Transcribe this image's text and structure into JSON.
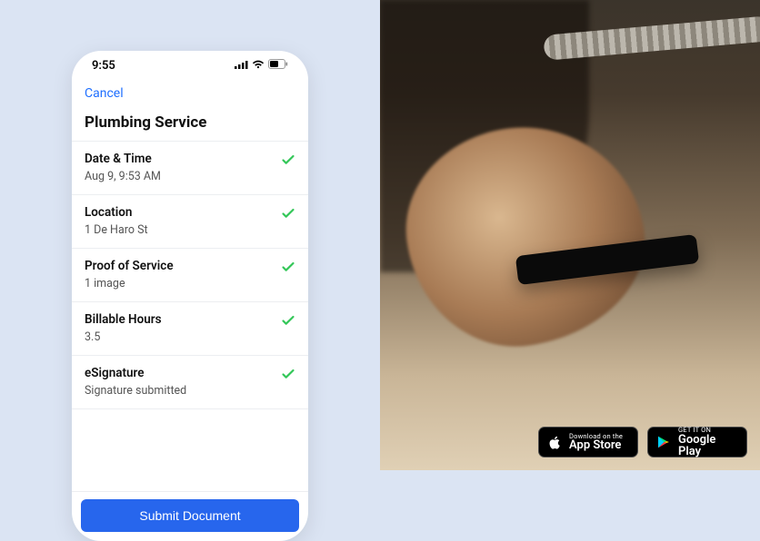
{
  "status": {
    "time": "9:55"
  },
  "nav": {
    "cancel": "Cancel"
  },
  "title": "Plumbing Service",
  "fields": {
    "datetime": {
      "label": "Date & Time",
      "value": "Aug 9, 9:53 AM"
    },
    "location": {
      "label": "Location",
      "value": "1 De Haro St"
    },
    "proof": {
      "label": "Proof of Service",
      "value": "1 image"
    },
    "billable": {
      "label": "Billable Hours",
      "value": "3.5"
    },
    "esig": {
      "label": "eSignature",
      "value": "Signature submitted"
    }
  },
  "submit": "Submit Document",
  "store": {
    "apple": {
      "top": "Download on the",
      "bottom": "App Store"
    },
    "google": {
      "top": "GET IT ON",
      "bottom": "Google Play"
    }
  },
  "colors": {
    "accent": "#2766ed",
    "check": "#34c759",
    "panel": "#dbe4f3"
  }
}
